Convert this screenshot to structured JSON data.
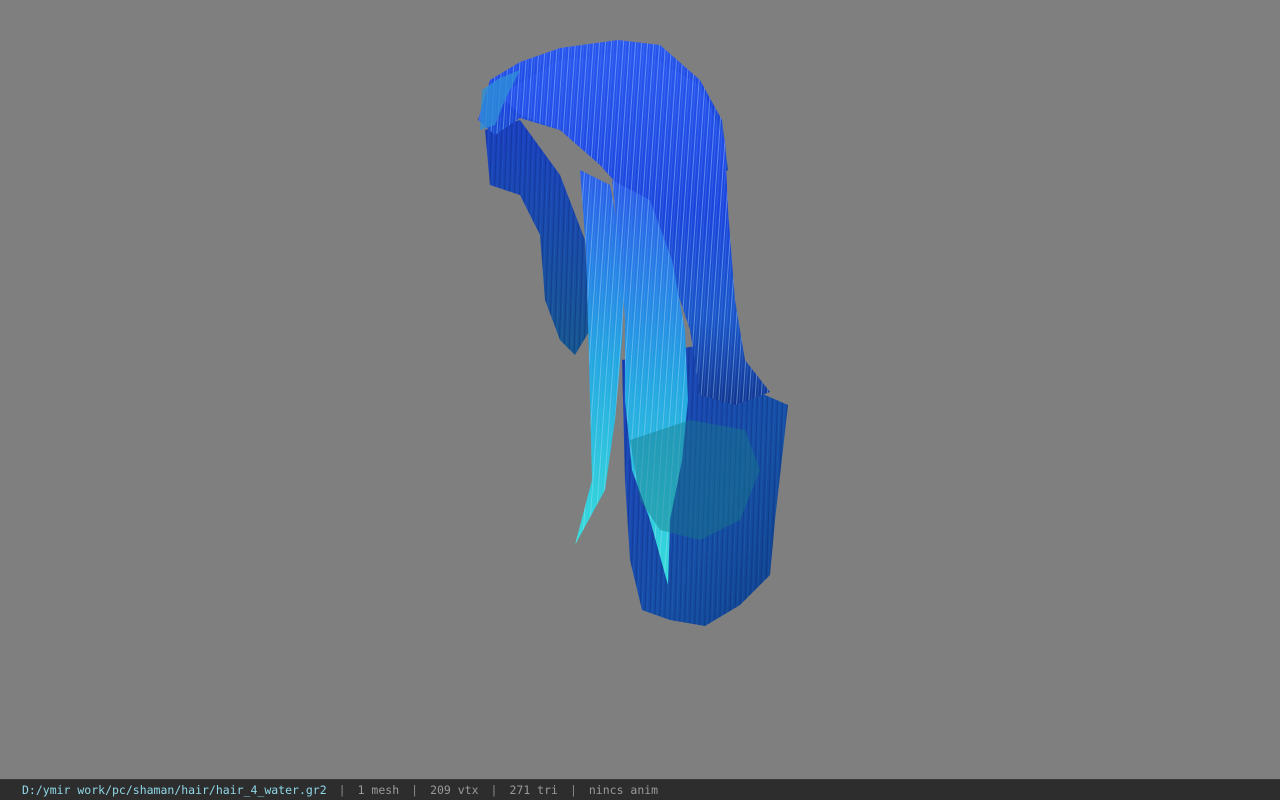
{
  "viewport": {
    "background": "#7f7f7f",
    "model": {
      "icon": "hair-mesh",
      "colors": {
        "base_blue": "#1a3fd8",
        "deep_blue": "#0a2a9a",
        "highlight": "#9fd4ff",
        "cyan_tips": "#2fd6d6",
        "teal_inner": "#1a6a8a"
      }
    }
  },
  "statusbar": {
    "file_path": "D:/ymir work/pc/shaman/hair/hair_4_water.gr2",
    "separator": "|",
    "mesh_count": "1 mesh",
    "vertex_count": "209 vtx",
    "triangle_count": "271 tri",
    "animation": "nincs anim"
  }
}
